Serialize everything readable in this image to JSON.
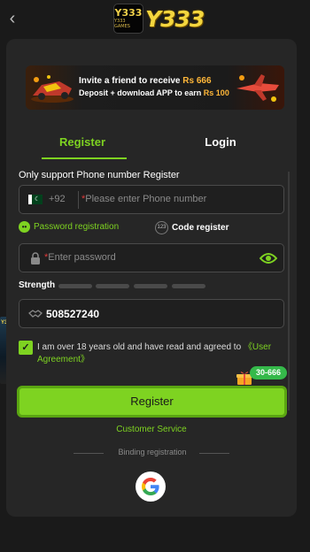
{
  "header": {
    "back_icon": "chevron-left-icon",
    "logo_badge_text": "Y333",
    "logo_badge_subtext": "Y333 GAMES",
    "logo_text": "Y333"
  },
  "banner": {
    "line1_prefix": "Invite a friend to receive",
    "line1_amount": "Rs 666",
    "line2_prefix": "Deposit + download APP to earn",
    "line2_amount": "Rs 100"
  },
  "tabs": [
    {
      "label": "Register",
      "active": true
    },
    {
      "label": "Login",
      "active": false
    }
  ],
  "form": {
    "phone_only_label": "Only support Phone number Register",
    "country_code": "+92",
    "phone_placeholder": "Please enter Phone number",
    "password_registration_label": "Password registration",
    "code_register_label": "Code register",
    "code_icon_text": "123",
    "password_placeholder": "Enter password",
    "strength_label": "Strength",
    "invite_code_value": "508527240",
    "agree_text": "I am over 18 years old and have read and agreed to",
    "agree_link": "《User Agreement》",
    "agree_checked": true
  },
  "actions": {
    "register_label": "Register",
    "customer_service_label": "Customer Service",
    "binding_label": "Binding registration"
  },
  "promo": {
    "badge_text": "30-666"
  },
  "colors": {
    "accent": "#7ed321",
    "background": "#1a1a1a",
    "panel": "#262626",
    "highlight": "#ffb739"
  }
}
